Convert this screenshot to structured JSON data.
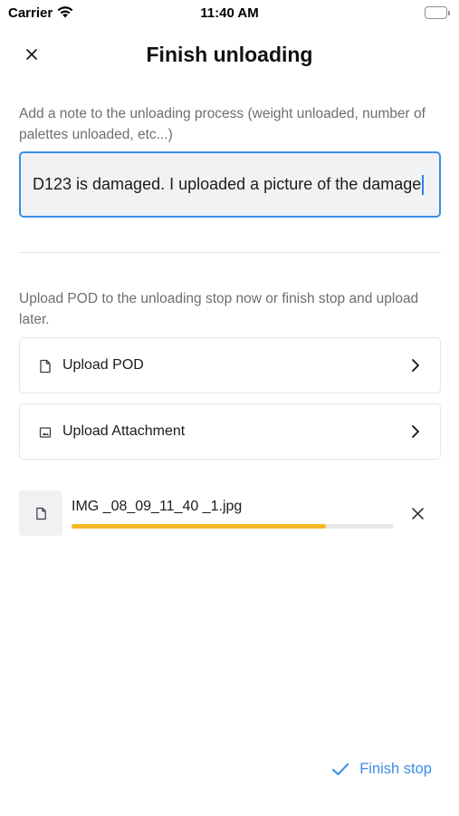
{
  "status_bar": {
    "carrier": "Carrier",
    "time": "11:40 AM"
  },
  "header": {
    "title": "Finish unloading",
    "close_icon": "close-icon"
  },
  "note": {
    "hint": "Add a note to the unloading process (weight unloaded, number of palettes unloaded, etc...)",
    "value": "D123 is damaged. I uploaded a picture of  the damage"
  },
  "pod": {
    "hint": "Upload POD to the unloading stop now or finish stop and upload later.",
    "upload_pod_label": "Upload POD",
    "upload_attachment_label": "Upload Attachment"
  },
  "uploads": [
    {
      "file_name": "IMG _08_09_11_40 _1.jpg",
      "progress": 0.79
    }
  ],
  "footer": {
    "finish_label": "Finish stop"
  },
  "colors": {
    "accent": "#3a8ee6",
    "progress": "#f5b820",
    "input_background": "#f0f2f4"
  }
}
